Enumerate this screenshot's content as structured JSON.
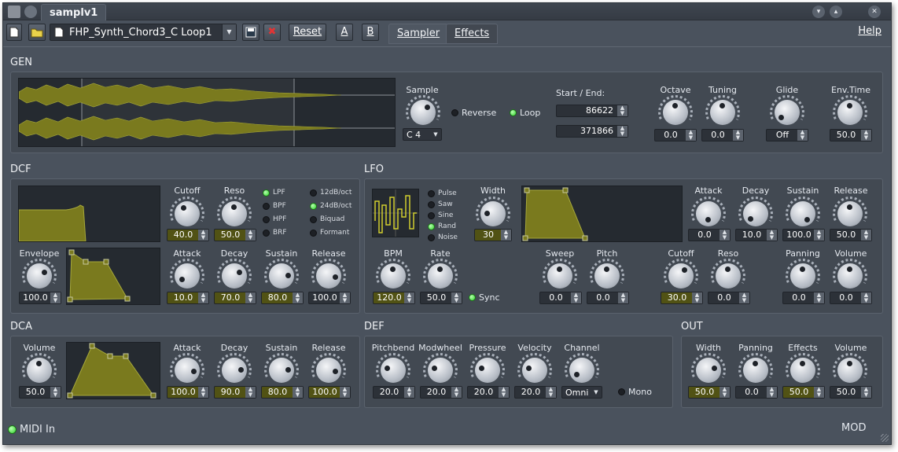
{
  "window": {
    "tab_title": "samplv1"
  },
  "toolbar": {
    "preset_name": "FHP_Synth_Chord3_C Loop1",
    "reset": "Reset",
    "a": "A",
    "b": "B",
    "tabs": [
      "Sampler",
      "Effects"
    ],
    "help": "Help"
  },
  "gen": {
    "title": "GEN",
    "sample_label": "Sample",
    "note": "C 4",
    "reverse": "Reverse",
    "loop": "Loop",
    "start_end_label": "Start / End:",
    "start": "86622",
    "end": "371866",
    "octave_label": "Octave",
    "octave": "0.0",
    "tuning_label": "Tuning",
    "tuning": "0.0",
    "glide_label": "Glide",
    "glide": "Off",
    "envtime_label": "Env.Time",
    "envtime": "50.0"
  },
  "dcf": {
    "title": "DCF",
    "cutoff_label": "Cutoff",
    "cutoff": "40.0",
    "reso_label": "Reso",
    "reso": "50.0",
    "types": [
      "LPF",
      "BPF",
      "HPF",
      "BRF"
    ],
    "slopes": [
      "12dB/oct",
      "24dB/oct",
      "Biquad",
      "Formant"
    ],
    "envelope_label": "Envelope",
    "envelope": "100.0",
    "attack_label": "Attack",
    "attack": "10.0",
    "decay_label": "Decay",
    "decay": "70.0",
    "sustain_label": "Sustain",
    "sustain": "80.0",
    "release_label": "Release",
    "release": "100.0"
  },
  "lfo": {
    "title": "LFO",
    "shapes": [
      "Pulse",
      "Saw",
      "Sine",
      "Rand",
      "Noise"
    ],
    "width_label": "Width",
    "width": "30",
    "attack_label": "Attack",
    "attack": "0.0",
    "decay_label": "Decay",
    "decay": "10.0",
    "sustain_label": "Sustain",
    "sustain": "100.0",
    "release_label": "Release",
    "release": "50.0",
    "bpm_label": "BPM",
    "bpm": "120.0",
    "rate_label": "Rate",
    "rate": "50.0",
    "sync": "Sync",
    "sweep_label": "Sweep",
    "sweep": "0.0",
    "pitch_label": "Pitch",
    "pitch": "0.0",
    "cutoff_label": "Cutoff",
    "cutoff": "30.0",
    "reso_label": "Reso",
    "reso": "0.0",
    "panning_label": "Panning",
    "panning": "0.0",
    "volume_label": "Volume",
    "volume": "0.0"
  },
  "dca": {
    "title": "DCA",
    "volume_label": "Volume",
    "volume": "50.0",
    "attack_label": "Attack",
    "attack": "100.0",
    "decay_label": "Decay",
    "decay": "90.0",
    "sustain_label": "Sustain",
    "sustain": "80.0",
    "release_label": "Release",
    "release": "100.0"
  },
  "def": {
    "title": "DEF",
    "pitchbend_label": "Pitchbend",
    "pitchbend": "20.0",
    "modwheel_label": "Modwheel",
    "modwheel": "20.0",
    "pressure_label": "Pressure",
    "pressure": "20.0",
    "velocity_label": "Velocity",
    "velocity": "20.0",
    "channel_label": "Channel",
    "channel": "Omni",
    "mono": "Mono"
  },
  "out": {
    "title": "OUT",
    "width_label": "Width",
    "width": "50.0",
    "panning_label": "Panning",
    "panning": "0.0",
    "effects_label": "Effects",
    "effects": "50.0",
    "volume_label": "Volume",
    "volume": "50.0"
  },
  "status": {
    "midi_in": "MIDI In",
    "mod": "MOD"
  },
  "colors": {
    "window_bg": "#4a525d",
    "panel_bg": "#424952",
    "graph_fill": "#7a7a1e",
    "led_on": "#2ed12a",
    "value_highlight": "#515214"
  }
}
